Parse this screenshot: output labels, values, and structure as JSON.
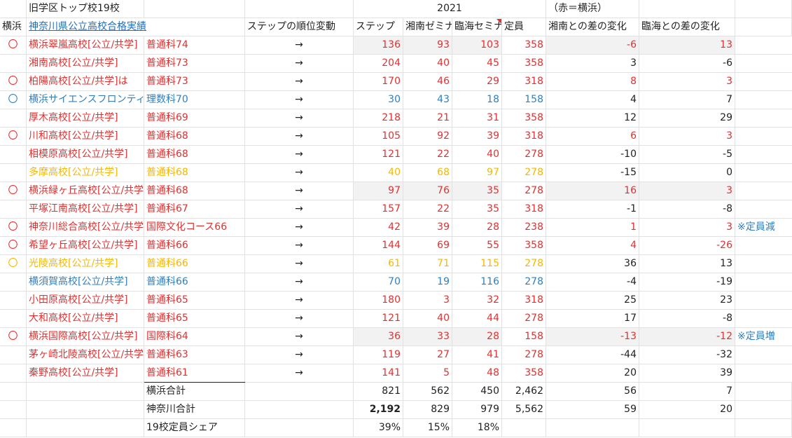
{
  "header1": {
    "title": "旧学区トップ校19校",
    "year": "2021",
    "legend_note": "（赤＝横浜）"
  },
  "header2": {
    "col_yokohama": "横浜",
    "col_link": "神奈川県公立高校合格実績",
    "col_rank_change": "ステップの順位変動",
    "col_step": "ステップ",
    "col_shonan": "湘南ゼミナール",
    "col_rinkai": "臨海セミナー",
    "col_capacity": "定員",
    "col_diff_shonan": "湘南との差の変化",
    "col_diff_rinkai": "臨海との差の変化"
  },
  "colors": {
    "red": "#e03131",
    "blue": "#2f7fc0",
    "yellow": "#f5b800",
    "black": "#222222"
  },
  "rows": [
    {
      "mark": "〇",
      "school": "横浜翠嵐高校[公立/共学]",
      "course": "普通科74",
      "arrow": "→",
      "step": "136",
      "shonan": "93",
      "rinkai": "103",
      "cap": "358",
      "d1": "-6",
      "d2": "13",
      "note": "",
      "color": "red",
      "shade": true
    },
    {
      "mark": "",
      "school": "湘南高校[公立/共学]",
      "course": "普通科73",
      "arrow": "→",
      "step": "204",
      "shonan": "40",
      "rinkai": "45",
      "cap": "358",
      "d1": "3",
      "d2": "-6",
      "note": "",
      "color": "red",
      "shade": false
    },
    {
      "mark": "〇",
      "school": "柏陽高校[公立/共学]は",
      "course": "普通科73",
      "arrow": "→",
      "step": "170",
      "shonan": "46",
      "rinkai": "29",
      "cap": "318",
      "d1": "8",
      "d2": "3",
      "note": "",
      "color": "red",
      "shade": false
    },
    {
      "mark": "〇",
      "school": "横浜サイエンスフロンティア",
      "course": "理数科70",
      "arrow": "→",
      "step": "30",
      "shonan": "43",
      "rinkai": "18",
      "cap": "158",
      "d1": "4",
      "d2": "7",
      "note": "",
      "color": "blue",
      "shade": false
    },
    {
      "mark": "",
      "school": "厚木高校[公立/共学]",
      "course": "普通科69",
      "arrow": "→",
      "step": "218",
      "shonan": "21",
      "rinkai": "31",
      "cap": "358",
      "d1": "12",
      "d2": "29",
      "note": "",
      "color": "red",
      "shade": false
    },
    {
      "mark": "〇",
      "school": "川和高校[公立/共学]",
      "course": "普通科68",
      "arrow": "→",
      "step": "105",
      "shonan": "92",
      "rinkai": "39",
      "cap": "318",
      "d1": "6",
      "d2": "3",
      "note": "",
      "color": "red",
      "shade": false
    },
    {
      "mark": "",
      "school": "相模原高校[公立/共学]",
      "course": "普通科68",
      "arrow": "→",
      "step": "121",
      "shonan": "22",
      "rinkai": "40",
      "cap": "278",
      "d1": "-10",
      "d2": "-5",
      "note": "",
      "color": "red",
      "shade": false
    },
    {
      "mark": "",
      "school": "多摩高校[公立/共学]",
      "course": "普通科68",
      "arrow": "→",
      "step": "40",
      "shonan": "68",
      "rinkai": "97",
      "cap": "278",
      "d1": "-15",
      "d2": "0",
      "note": "",
      "color": "yellow",
      "shade": false
    },
    {
      "mark": "〇",
      "school": "横浜緑ヶ丘高校[公立/共学]",
      "course": "普通科68",
      "arrow": "→",
      "step": "97",
      "shonan": "76",
      "rinkai": "35",
      "cap": "278",
      "d1": "16",
      "d2": "3",
      "note": "",
      "color": "red",
      "shade": true
    },
    {
      "mark": "",
      "school": "平塚江南高校[公立/共学]",
      "course": "普通科67",
      "arrow": "→",
      "step": "157",
      "shonan": "22",
      "rinkai": "35",
      "cap": "318",
      "d1": "-1",
      "d2": "-8",
      "note": "",
      "color": "red",
      "shade": false
    },
    {
      "mark": "〇",
      "school": "神奈川総合高校[公立/共学]",
      "course": "国際文化コース66",
      "arrow": "→",
      "step": "42",
      "shonan": "39",
      "rinkai": "28",
      "cap": "238",
      "d1": "1",
      "d2": "3",
      "note": "※定員減",
      "color": "red",
      "shade": false
    },
    {
      "mark": "〇",
      "school": "希望ヶ丘高校[公立/共学]",
      "course": "普通科66",
      "arrow": "→",
      "step": "144",
      "shonan": "69",
      "rinkai": "55",
      "cap": "358",
      "d1": "4",
      "d2": "-26",
      "note": "",
      "color": "red",
      "shade": false
    },
    {
      "mark": "〇",
      "school": "光陵高校[公立/共学]",
      "course": "普通科66",
      "arrow": "→",
      "step": "61",
      "shonan": "71",
      "rinkai": "115",
      "cap": "278",
      "d1": "36",
      "d2": "13",
      "note": "",
      "color": "yellow",
      "shade": false
    },
    {
      "mark": "",
      "school": "横須賀高校[公立/共学]",
      "course": "普通科66",
      "arrow": "→",
      "step": "70",
      "shonan": "19",
      "rinkai": "116",
      "cap": "278",
      "d1": "-4",
      "d2": "-19",
      "note": "",
      "color": "blue",
      "shade": false
    },
    {
      "mark": "",
      "school": "小田原高校[公立/共学]",
      "course": "普通科65",
      "arrow": "→",
      "step": "180",
      "shonan": "3",
      "rinkai": "32",
      "cap": "318",
      "d1": "25",
      "d2": "23",
      "note": "",
      "color": "red",
      "shade": false
    },
    {
      "mark": "",
      "school": "大和高校[公立/共学]",
      "course": "普通科65",
      "arrow": "→",
      "step": "121",
      "shonan": "40",
      "rinkai": "44",
      "cap": "278",
      "d1": "17",
      "d2": "-8",
      "note": "",
      "color": "red",
      "shade": false
    },
    {
      "mark": "〇",
      "school": "横浜国際高校[公立/共学]",
      "course": "国際科64",
      "arrow": "→",
      "step": "36",
      "shonan": "33",
      "rinkai": "28",
      "cap": "158",
      "d1": "-13",
      "d2": "-12",
      "note": "※定員増",
      "color": "red",
      "shade": true
    },
    {
      "mark": "",
      "school": "茅ヶ崎北陵高校[公立/共学]",
      "course": "普通科63",
      "arrow": "→",
      "step": "119",
      "shonan": "27",
      "rinkai": "41",
      "cap": "278",
      "d1": "-44",
      "d2": "-32",
      "note": "",
      "color": "red",
      "shade": false
    },
    {
      "mark": "",
      "school": "秦野高校[公立/共学]",
      "course": "普通科61",
      "arrow": "→",
      "step": "141",
      "shonan": "5",
      "rinkai": "48",
      "cap": "358",
      "d1": "20",
      "d2": "39",
      "note": "",
      "color": "red",
      "shade": false
    }
  ],
  "summary": [
    {
      "label": "横浜合計",
      "step": "821",
      "shonan": "562",
      "rinkai": "450",
      "cap": "2,462",
      "d1": "56",
      "d2": "7",
      "bold_step": false
    },
    {
      "label": "神奈川合計",
      "step": "2,192",
      "shonan": "829",
      "rinkai": "979",
      "cap": "5,562",
      "d1": "59",
      "d2": "20",
      "bold_step": true
    },
    {
      "label": "19校定員シェア",
      "step": "39%",
      "shonan": "15%",
      "rinkai": "18%",
      "cap": "",
      "d1": "",
      "d2": "",
      "bold_step": false
    }
  ]
}
